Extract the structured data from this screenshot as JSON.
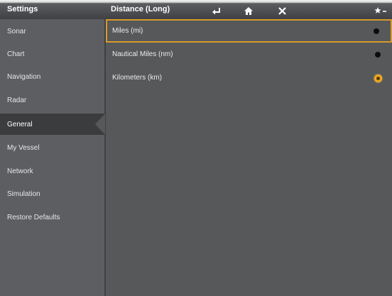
{
  "header": {
    "left_title": "Settings",
    "right_title": "Distance (Long)",
    "buttons": {
      "back_icon": "back-arrow-icon",
      "home_icon": "home-icon",
      "close_icon": "close-icon",
      "corner_icon": "star-menu-icon"
    }
  },
  "sidebar": {
    "items": [
      {
        "label": "Sonar"
      },
      {
        "label": "Chart"
      },
      {
        "label": "Navigation"
      },
      {
        "label": "Radar"
      },
      {
        "label": "General"
      },
      {
        "label": "My Vessel"
      },
      {
        "label": "Network"
      },
      {
        "label": "Simulation"
      },
      {
        "label": "Restore Defaults"
      }
    ],
    "selected": "General"
  },
  "options": [
    {
      "label": "Miles (mi)",
      "selected": false
    },
    {
      "label": "Nautical Miles (nm)",
      "selected": false
    },
    {
      "label": "Kilometers (km)",
      "selected": true
    }
  ],
  "colors": {
    "focus_border": "#d69a2c",
    "radio_selected": "#f0a81e",
    "background": "#56585a"
  }
}
